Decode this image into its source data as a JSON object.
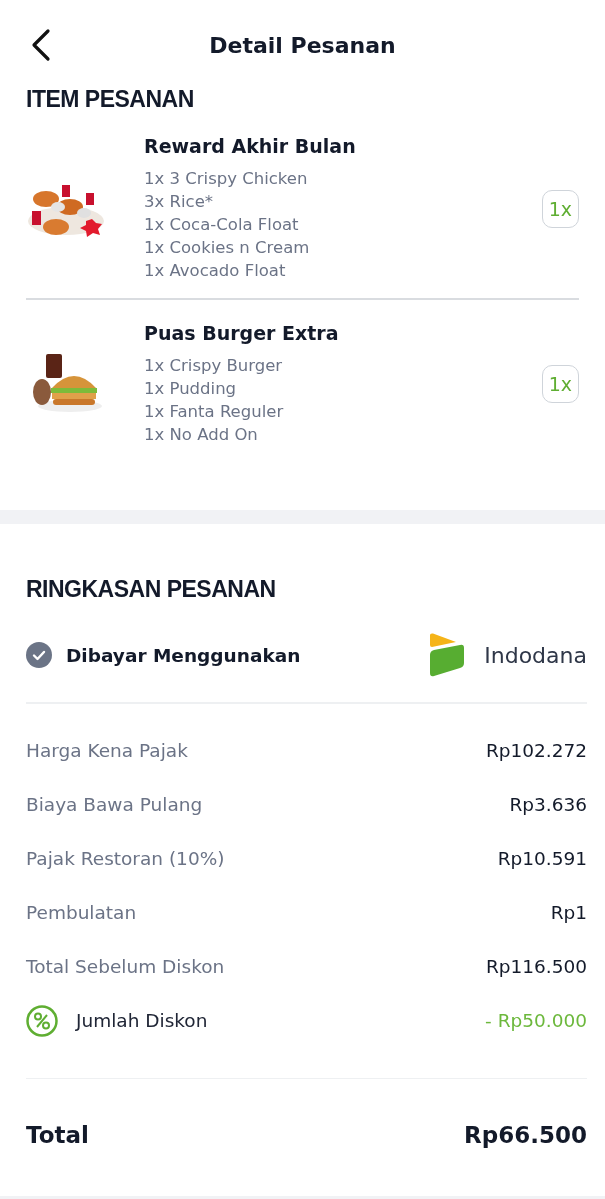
{
  "header": {
    "title": "Detail Pesanan"
  },
  "items_section": {
    "title": "ITEM PESANAN",
    "items": [
      {
        "name": "Reward Akhir Bulan",
        "details": [
          "1x 3 Crispy Chicken",
          "3x Rice*",
          "1x Coca-Cola Float",
          "1x Cookies n Cream",
          "1x Avocado Float"
        ],
        "quantity": "1x",
        "kind": "chicken"
      },
      {
        "name": "Puas Burger Extra",
        "details": [
          "1x Crispy Burger",
          "1x Pudding",
          "1x Fanta Reguler",
          "1x No Add On"
        ],
        "quantity": "1x",
        "kind": "burger"
      }
    ]
  },
  "summary": {
    "title": "RINGKASAN PESANAN",
    "payment": {
      "label": "Dibayar Menggunakan",
      "method": "Indodana"
    },
    "rows": [
      {
        "label": "Harga Kena Pajak",
        "value": "Rp102.272",
        "kind": "plain"
      },
      {
        "label": "Biaya Bawa Pulang",
        "value": "Rp3.636",
        "kind": "plain"
      },
      {
        "label": "Pajak Restoran (10%)",
        "value": "Rp10.591",
        "kind": "plain"
      },
      {
        "label": "Pembulatan",
        "value": "Rp1",
        "kind": "plain"
      },
      {
        "label": "Total Sebelum Diskon",
        "value": "Rp116.500",
        "kind": "plain"
      },
      {
        "label": "Jumlah Diskon",
        "value": "- Rp50.000",
        "kind": "discount"
      }
    ],
    "total": {
      "label": "Total",
      "value": "Rp66.500"
    }
  }
}
